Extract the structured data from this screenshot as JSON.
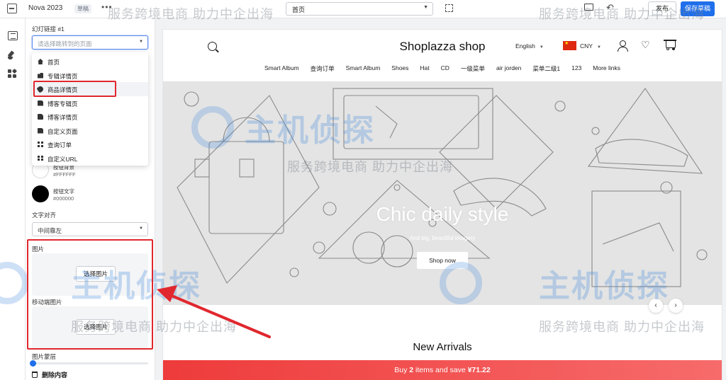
{
  "topbar": {
    "theme_name": "Nova 2023",
    "theme_badge": "草稿",
    "more": "•••",
    "page_select": "首页",
    "publish_label": "发布",
    "save_label": "保存草稿"
  },
  "rail": {
    "icons": [
      "sections-icon",
      "brush-icon",
      "apps-icon"
    ]
  },
  "panel": {
    "link_label": "幻灯链接 #1",
    "link_placeholder": "请选择跳转到的页面",
    "swatches": [
      {
        "name": "按钮背景",
        "hex": "#FFFFFF",
        "color": "#FFFFFF"
      },
      {
        "name": "按钮文字",
        "hex": "#000000",
        "color": "#000000"
      }
    ],
    "align_label": "文字对齐",
    "align_value": "中间靠左",
    "image_label": "图片",
    "image_button": "选择图片",
    "mobile_image_label": "移动端图片",
    "mobile_image_button": "选择图片",
    "overlay_label": "图片蒙层",
    "delete_label": "删除内容"
  },
  "menu": {
    "items": [
      {
        "label": "首页",
        "icon": "home-icon"
      },
      {
        "label": "专辑详情页",
        "icon": "collection-icon"
      },
      {
        "label": "商品详情页",
        "icon": "tag-icon"
      },
      {
        "label": "博客专辑页",
        "icon": "blog-list-icon"
      },
      {
        "label": "博客详情页",
        "icon": "blog-post-icon"
      },
      {
        "label": "自定义页面",
        "icon": "page-icon"
      },
      {
        "label": "查询订单",
        "icon": "order-grid-icon"
      },
      {
        "label": "自定义URL",
        "icon": "url-grid-icon"
      }
    ],
    "highlighted_index": 2
  },
  "preview": {
    "store_title": "Shoplazza shop",
    "language": "English",
    "currency": "CNY",
    "nav": [
      "Smart Album",
      "查询订单",
      "Smart Album",
      "Shoes",
      "Hat",
      "CD",
      "一级菜单",
      "air jorden",
      "菜单二级1",
      "123",
      "More links"
    ],
    "hero_title": "Chic daily style",
    "hero_subtitle": "And big, beautiful imagery",
    "hero_button": "Shop now",
    "prev": "‹",
    "next": "›",
    "section_title": "New Arrivals",
    "promo_prefix": "Buy ",
    "promo_count": "2",
    "promo_middle": " items and save ",
    "promo_amount": "¥71.22"
  },
  "watermarks": {
    "slogan": "服务跨境电商 助力中企出海",
    "brand": "主机侦探"
  },
  "colors": {
    "accent": "#1f6feb",
    "annotation_red": "#e0282e",
    "promo_red": "#ee3b3b"
  }
}
